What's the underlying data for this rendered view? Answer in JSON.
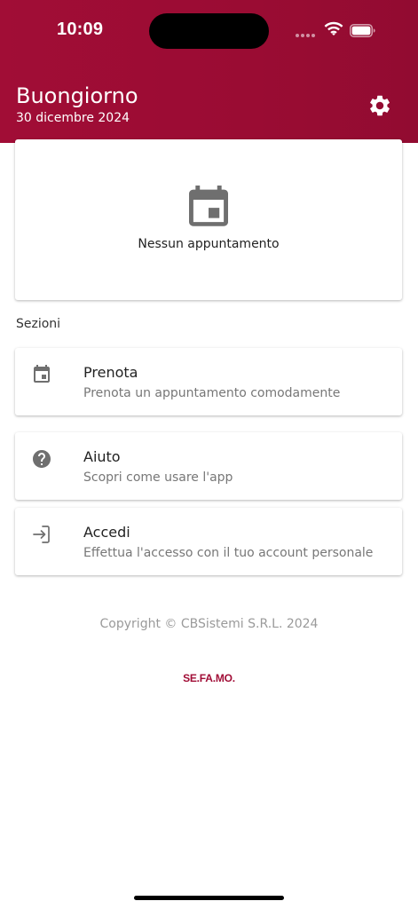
{
  "status_bar": {
    "time": "10:09",
    "icons": [
      "signal-dots-icon",
      "wifi-icon",
      "battery-icon"
    ]
  },
  "header": {
    "greeting": "Buongiorno",
    "date": "30 dicembre 2024",
    "settings_icon": "gear-icon",
    "background_color": "#a10d36"
  },
  "appointments": {
    "icon": "calendar-icon",
    "empty_text": "Nessun appuntamento"
  },
  "sections": {
    "title": "Sezioni",
    "items": [
      {
        "icon": "calendar-icon",
        "title": "Prenota",
        "subtitle": "Prenota un appuntamento comodamente"
      },
      {
        "icon": "help-icon",
        "title": "Aiuto",
        "subtitle": "Scopri come usare l'app"
      },
      {
        "icon": "login-icon",
        "title": "Accedi",
        "subtitle": "Effettua l'accesso con il tuo account personale"
      }
    ]
  },
  "footer": {
    "copyright": "Copyright © CBSistemi S.R.L. 2024",
    "brand": "SE.FA.MO.",
    "brand_color": "#a10d36"
  }
}
